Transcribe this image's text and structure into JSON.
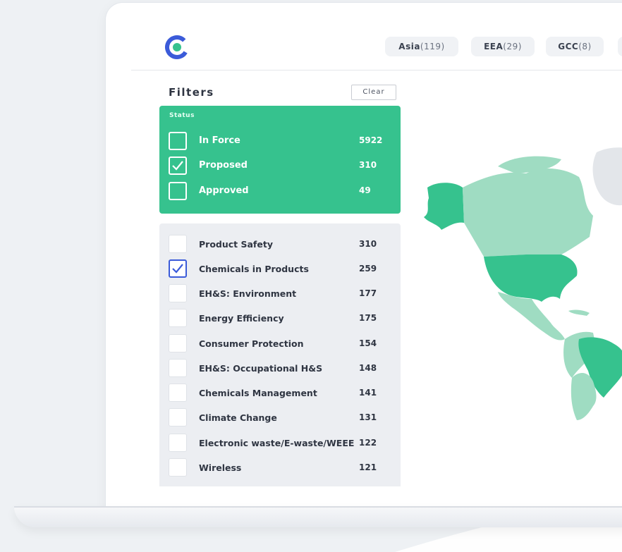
{
  "header": {
    "regions": [
      {
        "name": "Asia",
        "count": "(119)"
      },
      {
        "name": "EEA",
        "count": "(29)"
      },
      {
        "name": "GCC",
        "count": "(8)"
      }
    ]
  },
  "filters": {
    "title": "Filters",
    "clear_label": "Clear",
    "status": {
      "label": "Status",
      "items": [
        {
          "label": "In Force",
          "count": "5922",
          "checked": false
        },
        {
          "label": "Proposed",
          "count": "310",
          "checked": true
        },
        {
          "label": "Approved",
          "count": "49",
          "checked": false
        }
      ]
    },
    "topics": [
      {
        "label": "Product Safety",
        "count": "310",
        "checked": false
      },
      {
        "label": "Chemicals in Products",
        "count": "259",
        "checked": true
      },
      {
        "label": "EH&S: Environment",
        "count": "177",
        "checked": false
      },
      {
        "label": "Energy Efficiency",
        "count": "175",
        "checked": false
      },
      {
        "label": "Consumer Protection",
        "count": "154",
        "checked": false
      },
      {
        "label": "EH&S: Occupational H&S",
        "count": "148",
        "checked": false
      },
      {
        "label": "Chemicals Management",
        "count": "141",
        "checked": false
      },
      {
        "label": "Climate Change",
        "count": "131",
        "checked": false
      },
      {
        "label": "Electronic waste/E-waste/WEEE",
        "count": "122",
        "checked": false
      },
      {
        "label": "Wireless",
        "count": "121",
        "checked": false
      }
    ]
  },
  "colors": {
    "accent_green": "#36c28e",
    "map_light": "#9fdcc2",
    "map_dark": "#36c28e",
    "check_blue": "#3b5bd9"
  }
}
